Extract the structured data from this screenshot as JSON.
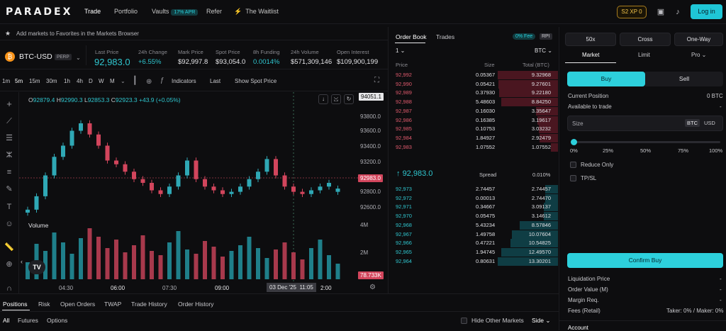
{
  "topnav": {
    "logo": "PARADEX",
    "items": [
      "Trade",
      "Portfolio",
      "Vaults",
      "Refer",
      "The Waitlist"
    ],
    "vaults_badge": "17% APR",
    "xp": "S2 XP 0",
    "login": "Log in"
  },
  "favbar": {
    "text": "Add markets to Favorites in the Markets Browser"
  },
  "market": {
    "symbol": "BTC-USD",
    "badge": "PERP",
    "stats": [
      {
        "label": "Last Price",
        "value": "92,983.0"
      },
      {
        "label": "24h Change",
        "value": "+6.55%"
      },
      {
        "label": "Mark Price",
        "value": "$92,997.8"
      },
      {
        "label": "Spot Price",
        "value": "$93,054.0"
      },
      {
        "label": "8h Funding",
        "value": "0.0014%"
      },
      {
        "label": "24h Volume",
        "value": "$571,309,146"
      },
      {
        "label": "Open Interest",
        "value": "$109,900,199"
      }
    ]
  },
  "chart_toolbar": {
    "timeframes": [
      "1m",
      "5m",
      "15m",
      "30m",
      "1h",
      "4h",
      "D",
      "W",
      "M"
    ],
    "indicators": "Indicators",
    "last": "Last",
    "spot": "Show Spot Price"
  },
  "ohlc": {
    "o": "92879.4",
    "h": "92990.3",
    "l": "92853.3",
    "c": "92923.3",
    "chg": "+43.9 (+0.05%)"
  },
  "price_axis": [
    "93800.0",
    "93600.0",
    "93400.0",
    "93200.0",
    "92800.0",
    "92600.0"
  ],
  "price_tags": {
    "top": "94051.1",
    "current": "92983.0",
    "volume": "78.733K"
  },
  "volume_axis": [
    "4M",
    "2M"
  ],
  "volume_label": "Volume",
  "time_axis": [
    "04:30",
    "06:00",
    "07:30",
    "09:00",
    "2:00"
  ],
  "crosshair_date": "03 Dec '25  11:05",
  "chart_data": {
    "type": "candlestick",
    "x": [
      "04:30",
      "06:00",
      "07:30",
      "09:00",
      "12:00"
    ],
    "close": [
      92640,
      92820,
      93100,
      93350,
      93500,
      93700,
      93800,
      93650,
      93500,
      93300,
      93250,
      93150,
      93050,
      93000,
      92900,
      92850,
      92950,
      93100,
      93300,
      93050,
      92950,
      92900,
      92850,
      92880,
      92950,
      93050,
      93150,
      93320,
      93100,
      92950,
      92880,
      92850,
      92900,
      92950,
      93000,
      92923.3
    ],
    "open": [
      92600,
      92640,
      92820,
      93100,
      93350,
      93500,
      93700,
      93800,
      93650,
      93500,
      93300,
      93250,
      93150,
      93050,
      93000,
      92900,
      92850,
      92950,
      93100,
      93300,
      93050,
      92950,
      92900,
      92850,
      92880,
      92950,
      93050,
      93150,
      93320,
      93100,
      92950,
      92880,
      92850,
      92900,
      92950,
      92879.4
    ],
    "volume_scale": "M",
    "volume": [
      1.2,
      2.5,
      2.0,
      3.3,
      2.6,
      1.8,
      2.9,
      3.6,
      3.0,
      2.2,
      2.8,
      1.9,
      2.4,
      3.1,
      2.0,
      1.7,
      2.6,
      3.4,
      2.1,
      1.8,
      2.7,
      2.3,
      1.6,
      2.0,
      2.4,
      3.0,
      2.2,
      1.5,
      2.1,
      2.6,
      1.9,
      1.4,
      2.2,
      2.8,
      1.7,
      1.1
    ],
    "ylim": [
      92500,
      94100
    ]
  },
  "orderbook": {
    "tabs": [
      "Order Book",
      "Trades"
    ],
    "fee_badge": "0% Fee",
    "rpi": "RPI",
    "tick": "1",
    "asset": "BTC",
    "headers": [
      "Price",
      "Size",
      "Total (BTC)"
    ],
    "asks": [
      [
        "92,992",
        "0.05367",
        "9.32968",
        1.0
      ],
      [
        "92,990",
        "0.05421",
        "9.27601",
        0.99
      ],
      [
        "92,989",
        "0.37930",
        "9.22180",
        0.98
      ],
      [
        "92,988",
        "5.48603",
        "8.84250",
        0.94
      ],
      [
        "92,987",
        "0.16030",
        "3.35647",
        0.36
      ],
      [
        "92,986",
        "0.16385",
        "3.19617",
        0.34
      ],
      [
        "92,985",
        "0.10753",
        "3.03232",
        0.32
      ],
      [
        "92,984",
        "1.84927",
        "2.92479",
        0.31
      ],
      [
        "92,983",
        "1.07552",
        "1.07552",
        0.12
      ]
    ],
    "mid": "92,983.0",
    "spread_label": "Spread",
    "spread": "0.010%",
    "bids": [
      [
        "92,973",
        "2.74457",
        "2.74457",
        0.21
      ],
      [
        "92,972",
        "0.00013",
        "2.74470",
        0.21
      ],
      [
        "92,971",
        "0.34667",
        "3.09137",
        0.23
      ],
      [
        "92,970",
        "0.05475",
        "3.14612",
        0.24
      ],
      [
        "92,968",
        "5.43234",
        "8.57846",
        0.64
      ],
      [
        "92,967",
        "1.49758",
        "10.07604",
        0.76
      ],
      [
        "92,966",
        "0.47221",
        "10.54825",
        0.79
      ],
      [
        "92,965",
        "1.94745",
        "12.49570",
        0.94
      ],
      [
        "92,964",
        "0.80631",
        "13.30201",
        1.0
      ]
    ]
  },
  "order_panel": {
    "leverage": "50x",
    "margin": "Cross",
    "mode": "One-Way",
    "types": [
      "Market",
      "Limit",
      "Pro"
    ],
    "buy": "Buy",
    "sell": "Sell",
    "current_position_label": "Current Position",
    "current_position": "0 BTC",
    "available_label": "Available to trade",
    "available": "-",
    "size_label": "Size",
    "units": [
      "BTC",
      "USD"
    ],
    "slider_marks": [
      "0%",
      "25%",
      "50%",
      "75%",
      "100%"
    ],
    "slider_value": 0,
    "reduce_only": "Reduce Only",
    "tpsl": "TP/SL",
    "confirm": "Confirm Buy",
    "info": [
      {
        "label": "Liquidation Price",
        "value": "-"
      },
      {
        "label": "Order Value (M)",
        "value": "-"
      },
      {
        "label": "Margin Req.",
        "value": "-"
      },
      {
        "label": "Fees (Retail)",
        "value": "Taker: 0% / Maker: 0%"
      }
    ],
    "account": "Account"
  },
  "bottom": {
    "tabs": [
      "Positions",
      "Risk",
      "Open Orders",
      "TWAP",
      "Trade History",
      "Order History"
    ],
    "filters": [
      "All",
      "Futures",
      "Options"
    ],
    "hide_other": "Hide Other Markets",
    "side": "Side"
  },
  "colors": {
    "accent": "#1fc6d6",
    "up": "#2fa8b5",
    "down": "#d2455c"
  }
}
